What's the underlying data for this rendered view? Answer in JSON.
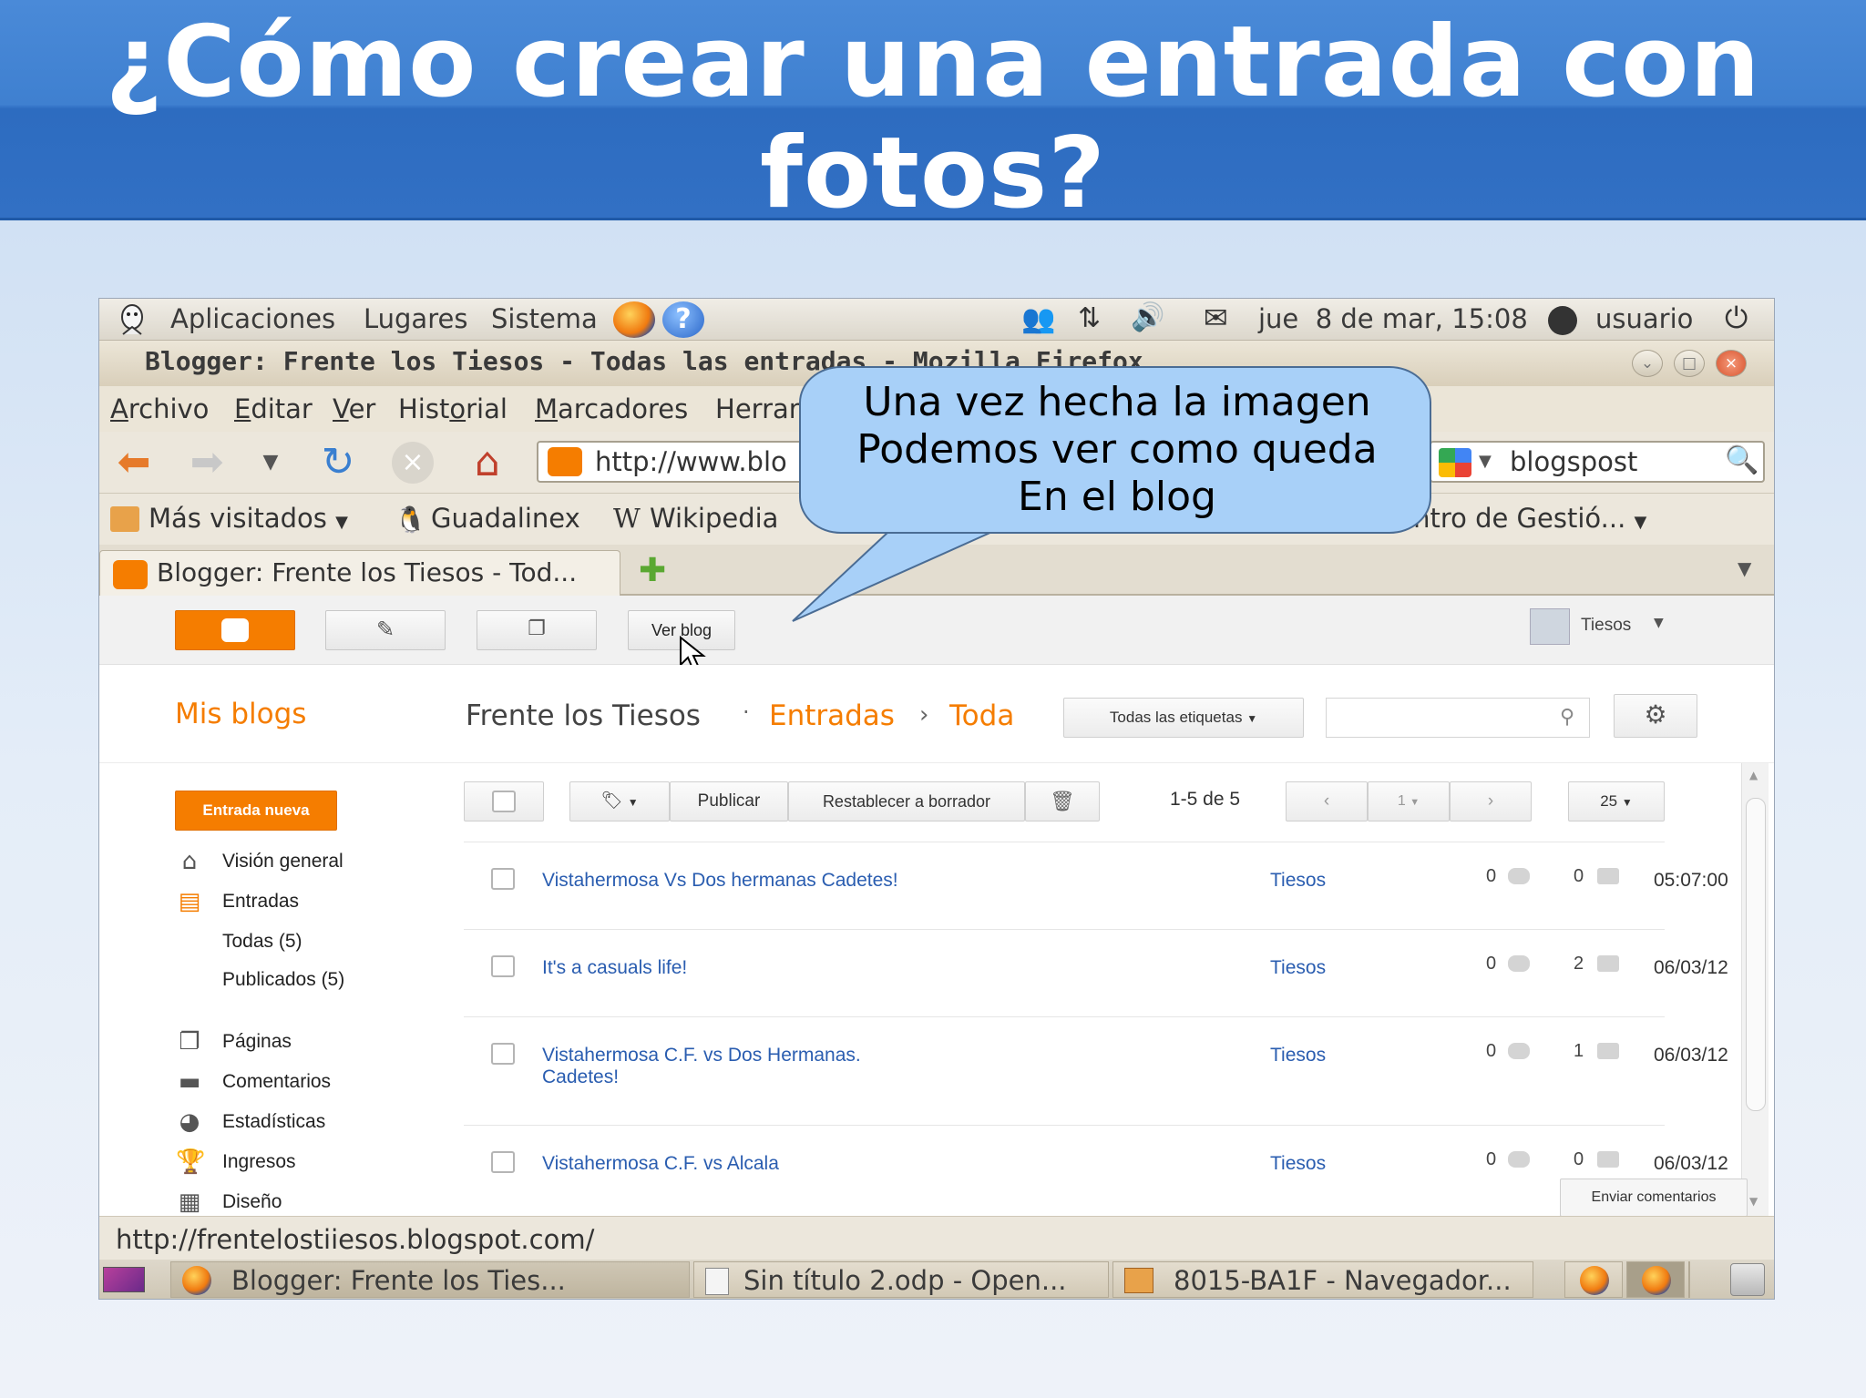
{
  "slide": {
    "title_line1": "¿Cómo crear una entrada con",
    "title_line2": "fotos?",
    "title_bg_color": "#3f80d0",
    "callout": {
      "line1": "Una vez hecha la imagen",
      "line2": "Podemos ver como queda",
      "line3": "En el blog",
      "fill_color": "#a8d0f8"
    }
  },
  "desktop_panel": {
    "menus": [
      "Aplicaciones",
      "Lugares",
      "Sistema"
    ],
    "icons": [
      "ubuntu-logo-icon",
      "firefox-icon",
      "help-icon",
      "network-icon",
      "transfer-icon",
      "volume-icon",
      "mail-icon",
      "user-status-icon",
      "power-icon"
    ],
    "clock": "jue  8 de mar, 15:08",
    "user": "usuario"
  },
  "browser": {
    "window_title": "Blogger: Frente los Tiesos - Todas las entradas - Mozilla Firefox",
    "menus": [
      {
        "label": "Archivo",
        "u": "A",
        "rest": "rchivo"
      },
      {
        "label": "Editar",
        "u": "E",
        "rest": "ditar"
      },
      {
        "label": "Ver",
        "u": "V",
        "rest": "er"
      },
      {
        "label": "Historial",
        "pre": "Hist",
        "u": "o",
        "rest": "rial"
      },
      {
        "label": "Marcadores",
        "u": "M",
        "rest": "arcadores"
      },
      {
        "label": "Herramientas",
        "pre": "",
        "u": "H",
        "rest": "erran"
      }
    ],
    "url": "http://www.blo",
    "search_value": "blogspost",
    "bookmarks": {
      "most_visited": "Más visitados",
      "guadalinex": "Guadalinex",
      "wikipedia": "Wikipedia",
      "centro": "Centro de Gestió..."
    },
    "tab_title": "Blogger: Frente los Tiesos - Tod...",
    "status_url": "http://frentelostiiesos.blogspot.com/"
  },
  "blogger": {
    "toolbar": {
      "view_blog": "Ver blog",
      "user": "Tiesos"
    },
    "header": {
      "my_blogs": "Mis blogs",
      "blog_name": "Frente los Tiesos",
      "section": "Entradas",
      "subsection": "Toda",
      "labels_filter": "Todas las etiquetas",
      "search_placeholder": ""
    },
    "sidebar": {
      "new_post": "Entrada nueva",
      "items": [
        {
          "label": "Visión general",
          "icon": "home-icon"
        },
        {
          "label": "Entradas",
          "icon": "posts-icon",
          "active": true
        },
        {
          "label": "Todas (5)",
          "sub": true,
          "active": true
        },
        {
          "label": "Publicados (5)",
          "sub": true
        },
        {
          "label": "Páginas",
          "icon": "pages-icon"
        },
        {
          "label": "Comentarios",
          "icon": "comments-icon"
        },
        {
          "label": "Estadísticas",
          "icon": "stats-icon"
        },
        {
          "label": "Ingresos",
          "icon": "earnings-icon"
        },
        {
          "label": "Diseño",
          "icon": "layout-icon"
        }
      ]
    },
    "actions": {
      "publish": "Publicar",
      "revert": "Restablecer a borrador",
      "range": "1-5 de 5",
      "page": "1",
      "per_page": "25"
    },
    "posts": [
      {
        "title": "Vistahermosa Vs Dos hermanas Cadetes!",
        "title2": "",
        "author": "Tiesos",
        "comments": "0",
        "views": "0",
        "date": "05:07:00"
      },
      {
        "title": "It's a casuals life!",
        "title2": "",
        "author": "Tiesos",
        "comments": "0",
        "views": "2",
        "date": "06/03/12"
      },
      {
        "title": "Vistahermosa C.F. vs Dos Hermanas.",
        "title2": "Cadetes!",
        "author": "Tiesos",
        "comments": "0",
        "views": "1",
        "date": "06/03/12"
      },
      {
        "title": "Vistahermosa C.F. vs Alcala",
        "title2": "",
        "author": "Tiesos",
        "comments": "0",
        "views": "0",
        "date": "06/03/12"
      }
    ],
    "feedback": "Enviar comentarios",
    "accent_color": "#f57d00",
    "link_color": "#2a5db0"
  },
  "taskbar": {
    "items": [
      "Blogger: Frente los Ties...",
      "Sin título 2.odp - Open...",
      "8015-BA1F - Navegador..."
    ]
  }
}
